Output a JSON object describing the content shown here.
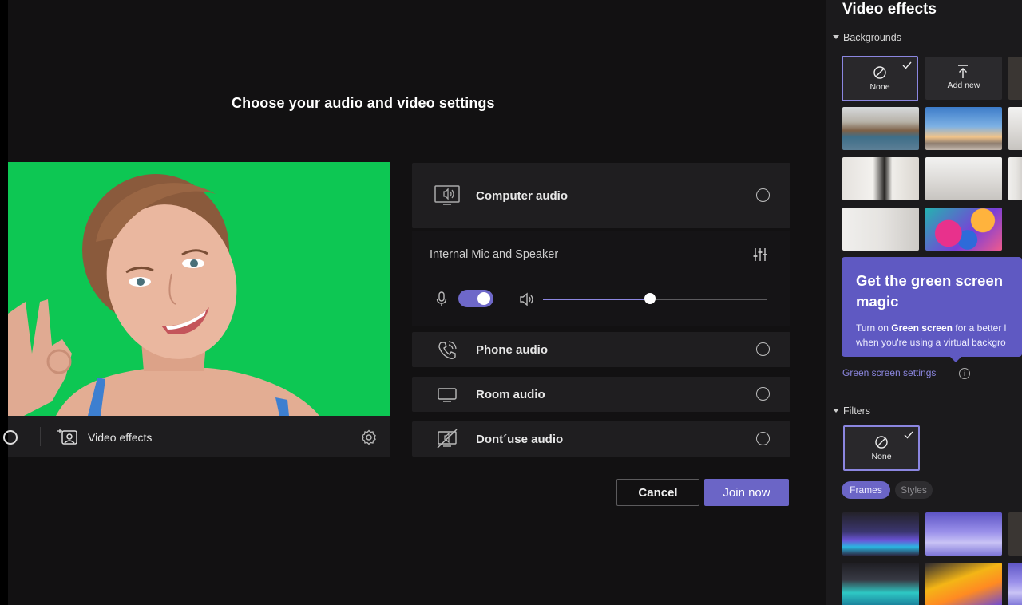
{
  "page": {
    "title": "Choose your audio and video settings"
  },
  "video": {
    "effects_label": "Video effects"
  },
  "audio": {
    "options": [
      {
        "label": "Computer audio",
        "icon": "computer-audio-icon",
        "selected": true
      },
      {
        "label": "Phone audio",
        "icon": "phone-audio-icon",
        "selected": false
      },
      {
        "label": "Room audio",
        "icon": "room-audio-icon",
        "selected": false
      },
      {
        "label": "Dont´use audio",
        "icon": "no-audio-icon",
        "selected": false
      }
    ],
    "device": {
      "name": "Internal Mic and Speaker",
      "mic_on": true,
      "speaker_volume": 0.48
    }
  },
  "actions": {
    "cancel": "Cancel",
    "join": "Join now"
  },
  "effects_panel": {
    "title": "Video effects",
    "backgrounds_label": "Backgrounds",
    "none_label": "None",
    "add_new_label": "Add new",
    "promo": {
      "heading": "Get the green screen magic",
      "body_prefix": "Turn on ",
      "body_bold": "Green screen",
      "body_suffix": " for a better l",
      "body_line2": "when you're using a virtual backgro"
    },
    "green_screen_settings": "Green screen settings",
    "info_glyph": "i",
    "filters_label": "Filters",
    "filter_none_label": "None",
    "chips": {
      "frames": "Frames",
      "styles": "Styles"
    }
  },
  "colors": {
    "accent": "#6b65c6",
    "green_screen": "#0dc753",
    "background": "#121112"
  }
}
